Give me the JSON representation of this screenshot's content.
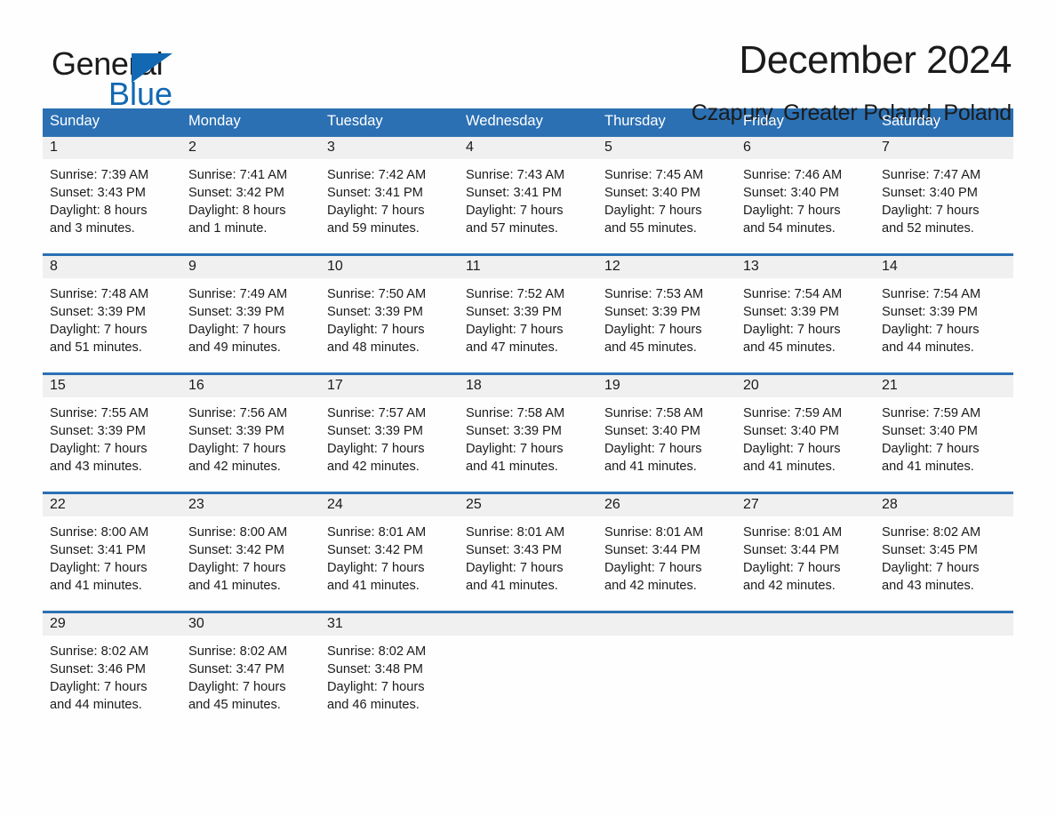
{
  "logo": {
    "word_general": "General",
    "word_blue": "Blue",
    "triangle_color": "#1268b3"
  },
  "header": {
    "title": "December 2024",
    "subtitle": "Czapury, Greater Poland, Poland"
  },
  "theme": {
    "header_blue": "#2b70b3",
    "daynum_band": "#f0f0f0",
    "page_background": "#fefefe",
    "text": "#1b1b1b"
  },
  "calendar": {
    "weekday_headers": [
      "Sunday",
      "Monday",
      "Tuesday",
      "Wednesday",
      "Thursday",
      "Friday",
      "Saturday"
    ],
    "weeks": [
      [
        {
          "day": "1",
          "sunrise": "Sunrise: 7:39 AM",
          "sunset": "Sunset: 3:43 PM",
          "daylight_line1": "Daylight: 8 hours",
          "daylight_line2": "and 3 minutes."
        },
        {
          "day": "2",
          "sunrise": "Sunrise: 7:41 AM",
          "sunset": "Sunset: 3:42 PM",
          "daylight_line1": "Daylight: 8 hours",
          "daylight_line2": "and 1 minute."
        },
        {
          "day": "3",
          "sunrise": "Sunrise: 7:42 AM",
          "sunset": "Sunset: 3:41 PM",
          "daylight_line1": "Daylight: 7 hours",
          "daylight_line2": "and 59 minutes."
        },
        {
          "day": "4",
          "sunrise": "Sunrise: 7:43 AM",
          "sunset": "Sunset: 3:41 PM",
          "daylight_line1": "Daylight: 7 hours",
          "daylight_line2": "and 57 minutes."
        },
        {
          "day": "5",
          "sunrise": "Sunrise: 7:45 AM",
          "sunset": "Sunset: 3:40 PM",
          "daylight_line1": "Daylight: 7 hours",
          "daylight_line2": "and 55 minutes."
        },
        {
          "day": "6",
          "sunrise": "Sunrise: 7:46 AM",
          "sunset": "Sunset: 3:40 PM",
          "daylight_line1": "Daylight: 7 hours",
          "daylight_line2": "and 54 minutes."
        },
        {
          "day": "7",
          "sunrise": "Sunrise: 7:47 AM",
          "sunset": "Sunset: 3:40 PM",
          "daylight_line1": "Daylight: 7 hours",
          "daylight_line2": "and 52 minutes."
        }
      ],
      [
        {
          "day": "8",
          "sunrise": "Sunrise: 7:48 AM",
          "sunset": "Sunset: 3:39 PM",
          "daylight_line1": "Daylight: 7 hours",
          "daylight_line2": "and 51 minutes."
        },
        {
          "day": "9",
          "sunrise": "Sunrise: 7:49 AM",
          "sunset": "Sunset: 3:39 PM",
          "daylight_line1": "Daylight: 7 hours",
          "daylight_line2": "and 49 minutes."
        },
        {
          "day": "10",
          "sunrise": "Sunrise: 7:50 AM",
          "sunset": "Sunset: 3:39 PM",
          "daylight_line1": "Daylight: 7 hours",
          "daylight_line2": "and 48 minutes."
        },
        {
          "day": "11",
          "sunrise": "Sunrise: 7:52 AM",
          "sunset": "Sunset: 3:39 PM",
          "daylight_line1": "Daylight: 7 hours",
          "daylight_line2": "and 47 minutes."
        },
        {
          "day": "12",
          "sunrise": "Sunrise: 7:53 AM",
          "sunset": "Sunset: 3:39 PM",
          "daylight_line1": "Daylight: 7 hours",
          "daylight_line2": "and 45 minutes."
        },
        {
          "day": "13",
          "sunrise": "Sunrise: 7:54 AM",
          "sunset": "Sunset: 3:39 PM",
          "daylight_line1": "Daylight: 7 hours",
          "daylight_line2": "and 45 minutes."
        },
        {
          "day": "14",
          "sunrise": "Sunrise: 7:54 AM",
          "sunset": "Sunset: 3:39 PM",
          "daylight_line1": "Daylight: 7 hours",
          "daylight_line2": "and 44 minutes."
        }
      ],
      [
        {
          "day": "15",
          "sunrise": "Sunrise: 7:55 AM",
          "sunset": "Sunset: 3:39 PM",
          "daylight_line1": "Daylight: 7 hours",
          "daylight_line2": "and 43 minutes."
        },
        {
          "day": "16",
          "sunrise": "Sunrise: 7:56 AM",
          "sunset": "Sunset: 3:39 PM",
          "daylight_line1": "Daylight: 7 hours",
          "daylight_line2": "and 42 minutes."
        },
        {
          "day": "17",
          "sunrise": "Sunrise: 7:57 AM",
          "sunset": "Sunset: 3:39 PM",
          "daylight_line1": "Daylight: 7 hours",
          "daylight_line2": "and 42 minutes."
        },
        {
          "day": "18",
          "sunrise": "Sunrise: 7:58 AM",
          "sunset": "Sunset: 3:39 PM",
          "daylight_line1": "Daylight: 7 hours",
          "daylight_line2": "and 41 minutes."
        },
        {
          "day": "19",
          "sunrise": "Sunrise: 7:58 AM",
          "sunset": "Sunset: 3:40 PM",
          "daylight_line1": "Daylight: 7 hours",
          "daylight_line2": "and 41 minutes."
        },
        {
          "day": "20",
          "sunrise": "Sunrise: 7:59 AM",
          "sunset": "Sunset: 3:40 PM",
          "daylight_line1": "Daylight: 7 hours",
          "daylight_line2": "and 41 minutes."
        },
        {
          "day": "21",
          "sunrise": "Sunrise: 7:59 AM",
          "sunset": "Sunset: 3:40 PM",
          "daylight_line1": "Daylight: 7 hours",
          "daylight_line2": "and 41 minutes."
        }
      ],
      [
        {
          "day": "22",
          "sunrise": "Sunrise: 8:00 AM",
          "sunset": "Sunset: 3:41 PM",
          "daylight_line1": "Daylight: 7 hours",
          "daylight_line2": "and 41 minutes."
        },
        {
          "day": "23",
          "sunrise": "Sunrise: 8:00 AM",
          "sunset": "Sunset: 3:42 PM",
          "daylight_line1": "Daylight: 7 hours",
          "daylight_line2": "and 41 minutes."
        },
        {
          "day": "24",
          "sunrise": "Sunrise: 8:01 AM",
          "sunset": "Sunset: 3:42 PM",
          "daylight_line1": "Daylight: 7 hours",
          "daylight_line2": "and 41 minutes."
        },
        {
          "day": "25",
          "sunrise": "Sunrise: 8:01 AM",
          "sunset": "Sunset: 3:43 PM",
          "daylight_line1": "Daylight: 7 hours",
          "daylight_line2": "and 41 minutes."
        },
        {
          "day": "26",
          "sunrise": "Sunrise: 8:01 AM",
          "sunset": "Sunset: 3:44 PM",
          "daylight_line1": "Daylight: 7 hours",
          "daylight_line2": "and 42 minutes."
        },
        {
          "day": "27",
          "sunrise": "Sunrise: 8:01 AM",
          "sunset": "Sunset: 3:44 PM",
          "daylight_line1": "Daylight: 7 hours",
          "daylight_line2": "and 42 minutes."
        },
        {
          "day": "28",
          "sunrise": "Sunrise: 8:02 AM",
          "sunset": "Sunset: 3:45 PM",
          "daylight_line1": "Daylight: 7 hours",
          "daylight_line2": "and 43 minutes."
        }
      ],
      [
        {
          "day": "29",
          "sunrise": "Sunrise: 8:02 AM",
          "sunset": "Sunset: 3:46 PM",
          "daylight_line1": "Daylight: 7 hours",
          "daylight_line2": "and 44 minutes."
        },
        {
          "day": "30",
          "sunrise": "Sunrise: 8:02 AM",
          "sunset": "Sunset: 3:47 PM",
          "daylight_line1": "Daylight: 7 hours",
          "daylight_line2": "and 45 minutes."
        },
        {
          "day": "31",
          "sunrise": "Sunrise: 8:02 AM",
          "sunset": "Sunset: 3:48 PM",
          "daylight_line1": "Daylight: 7 hours",
          "daylight_line2": "and 46 minutes."
        },
        {
          "day": "",
          "sunrise": "",
          "sunset": "",
          "daylight_line1": "",
          "daylight_line2": "",
          "empty": true
        },
        {
          "day": "",
          "sunrise": "",
          "sunset": "",
          "daylight_line1": "",
          "daylight_line2": "",
          "empty": true
        },
        {
          "day": "",
          "sunrise": "",
          "sunset": "",
          "daylight_line1": "",
          "daylight_line2": "",
          "empty": true
        },
        {
          "day": "",
          "sunrise": "",
          "sunset": "",
          "daylight_line1": "",
          "daylight_line2": "",
          "empty": true
        }
      ]
    ]
  }
}
